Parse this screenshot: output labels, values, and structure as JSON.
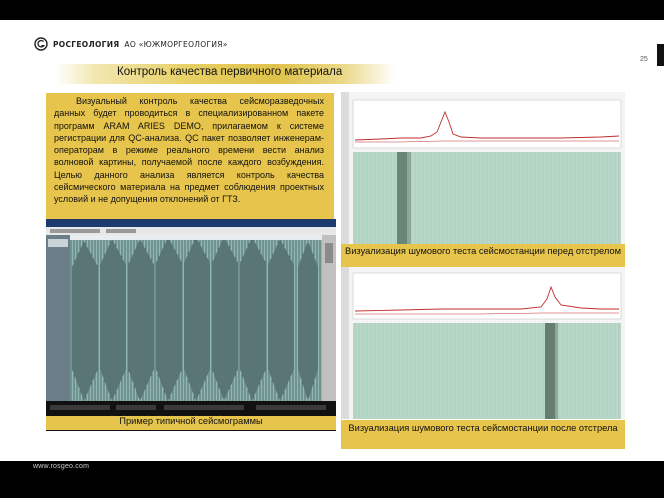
{
  "header": {
    "brand": "РОСГЕОЛОГИЯ",
    "subsidiary": "АО «ЮЖМОРГЕОЛОГИЯ»",
    "page_number": "25"
  },
  "title": "Контроль качества первичного материала",
  "description": "Визуальный контроль качества сейсморазведочных данных будет проводиться в специализированном пакете программ ARAM ARIES DEMO, прилагаемом к системе регистрации для QC-анализа. QC пакет позволяет инженерам-операторам в режиме реального времени вести анализ волновой картины, получаемой после каждого возбуждения. Целью данного анализа является контроль качества сейсмического материала на предмет соблюдения проектных условий и не допущения отклонений от ГТЗ.",
  "captions": {
    "seismogram": "Пример типичной сейсмограммы",
    "noise_before": "Визуализация шумового теста сейсмостанции перед отстрелом",
    "noise_after": "Визуализация шумового теста сейсмостанции после отстрела"
  },
  "footer": {
    "url": "www.rosgeo.com"
  },
  "colors": {
    "accent": "#e7c54c",
    "background": "#000000",
    "slide": "#ffffff"
  }
}
